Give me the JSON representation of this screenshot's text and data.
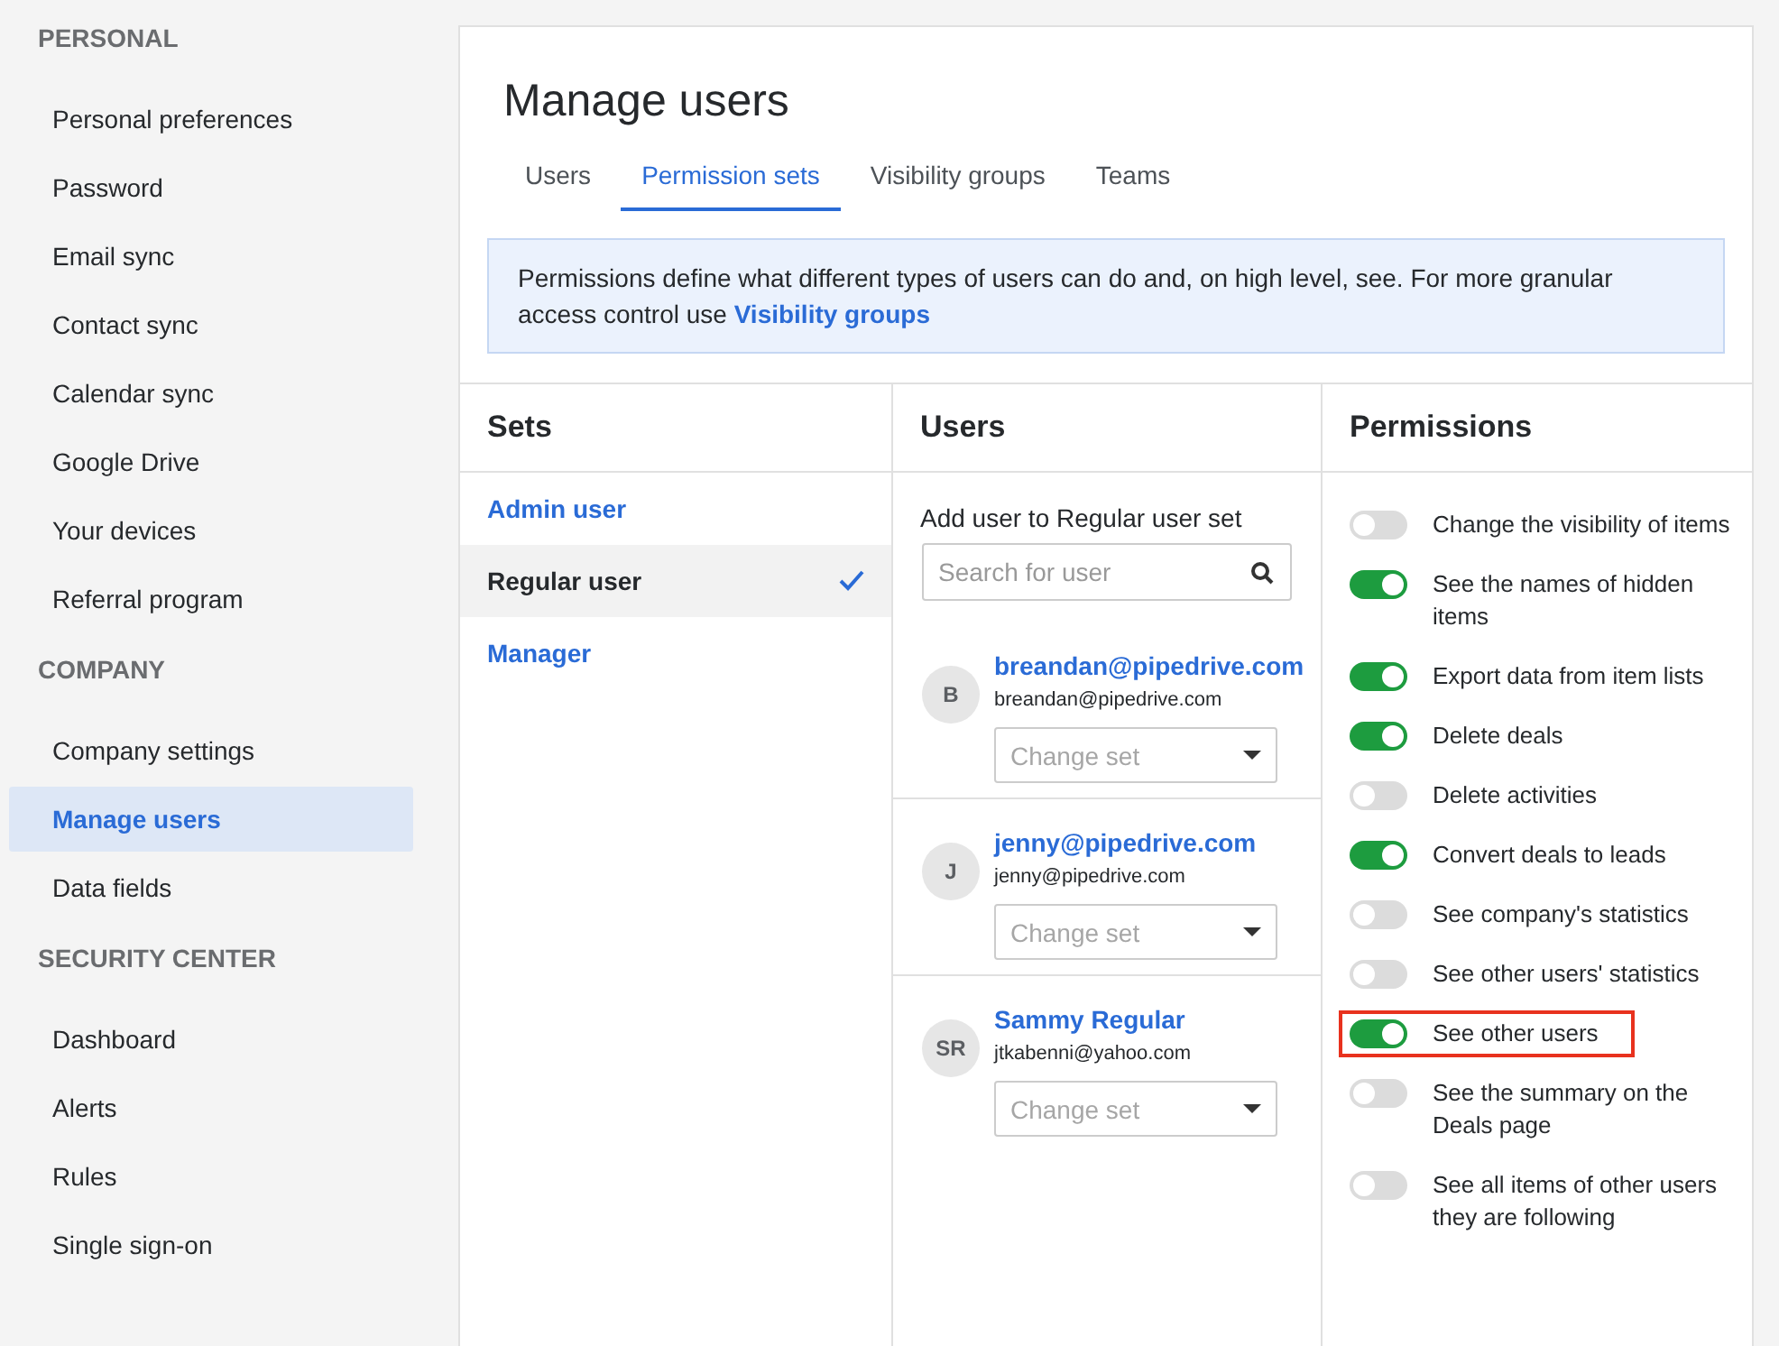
{
  "sidebar": {
    "sections": [
      {
        "title": "PERSONAL",
        "items": [
          {
            "label": "Personal preferences",
            "selected": false
          },
          {
            "label": "Password",
            "selected": false
          },
          {
            "label": "Email sync",
            "selected": false
          },
          {
            "label": "Contact sync",
            "selected": false
          },
          {
            "label": "Calendar sync",
            "selected": false
          },
          {
            "label": "Google Drive",
            "selected": false
          },
          {
            "label": "Your devices",
            "selected": false
          },
          {
            "label": "Referral program",
            "selected": false
          }
        ]
      },
      {
        "title": "COMPANY",
        "items": [
          {
            "label": "Company settings",
            "selected": false
          },
          {
            "label": "Manage users",
            "selected": true
          },
          {
            "label": "Data fields",
            "selected": false
          }
        ]
      },
      {
        "title": "SECURITY CENTER",
        "items": [
          {
            "label": "Dashboard",
            "selected": false
          },
          {
            "label": "Alerts",
            "selected": false
          },
          {
            "label": "Rules",
            "selected": false
          },
          {
            "label": "Single sign-on",
            "selected": false
          }
        ]
      }
    ]
  },
  "page": {
    "title": "Manage users",
    "tabs": [
      {
        "label": "Users",
        "selected": false
      },
      {
        "label": "Permission sets",
        "selected": true
      },
      {
        "label": "Visibility groups",
        "selected": false
      },
      {
        "label": "Teams",
        "selected": false
      }
    ],
    "notice": {
      "text": "Permissions define what different types of users can do and, on high level, see. For more granular access control use",
      "link": "Visibility groups"
    },
    "sets": {
      "heading": "Sets",
      "items": [
        {
          "label": "Admin user",
          "selected": false
        },
        {
          "label": "Regular user",
          "selected": true
        },
        {
          "label": "Manager",
          "selected": false
        }
      ]
    },
    "users": {
      "heading": "Users",
      "add_label": "Add user to Regular user set",
      "search": {
        "placeholder": "Search for user"
      },
      "items": [
        {
          "initials": "B",
          "name": "breandan@pipedrive.com",
          "email": "breandan@pipedrive.com",
          "select_placeholder": "Change set"
        },
        {
          "initials": "J",
          "name": "jenny@pipedrive.com",
          "email": "jenny@pipedrive.com",
          "select_placeholder": "Change set"
        },
        {
          "initials": "SR",
          "name": "Sammy Regular",
          "email": "jtkabenni@yahoo.com",
          "select_placeholder": "Change set"
        }
      ]
    },
    "permissions": {
      "heading": "Permissions",
      "items": [
        {
          "label": "Change the visibility of items",
          "on": false,
          "highlighted": false
        },
        {
          "label": "See the names of hidden items",
          "on": true,
          "highlighted": false
        },
        {
          "label": "Export data from item lists",
          "on": true,
          "highlighted": false
        },
        {
          "label": "Delete deals",
          "on": true,
          "highlighted": false
        },
        {
          "label": "Delete activities",
          "on": false,
          "highlighted": false
        },
        {
          "label": "Convert deals to leads",
          "on": true,
          "highlighted": false
        },
        {
          "label": "See company's statistics",
          "on": false,
          "highlighted": false
        },
        {
          "label": "See other users' statistics",
          "on": false,
          "highlighted": false
        },
        {
          "label": "See other users",
          "on": true,
          "highlighted": true
        },
        {
          "label": "See the summary on the Deals page",
          "on": false,
          "highlighted": false
        },
        {
          "label": "See all items of other users they are following",
          "on": false,
          "highlighted": false
        }
      ]
    }
  }
}
